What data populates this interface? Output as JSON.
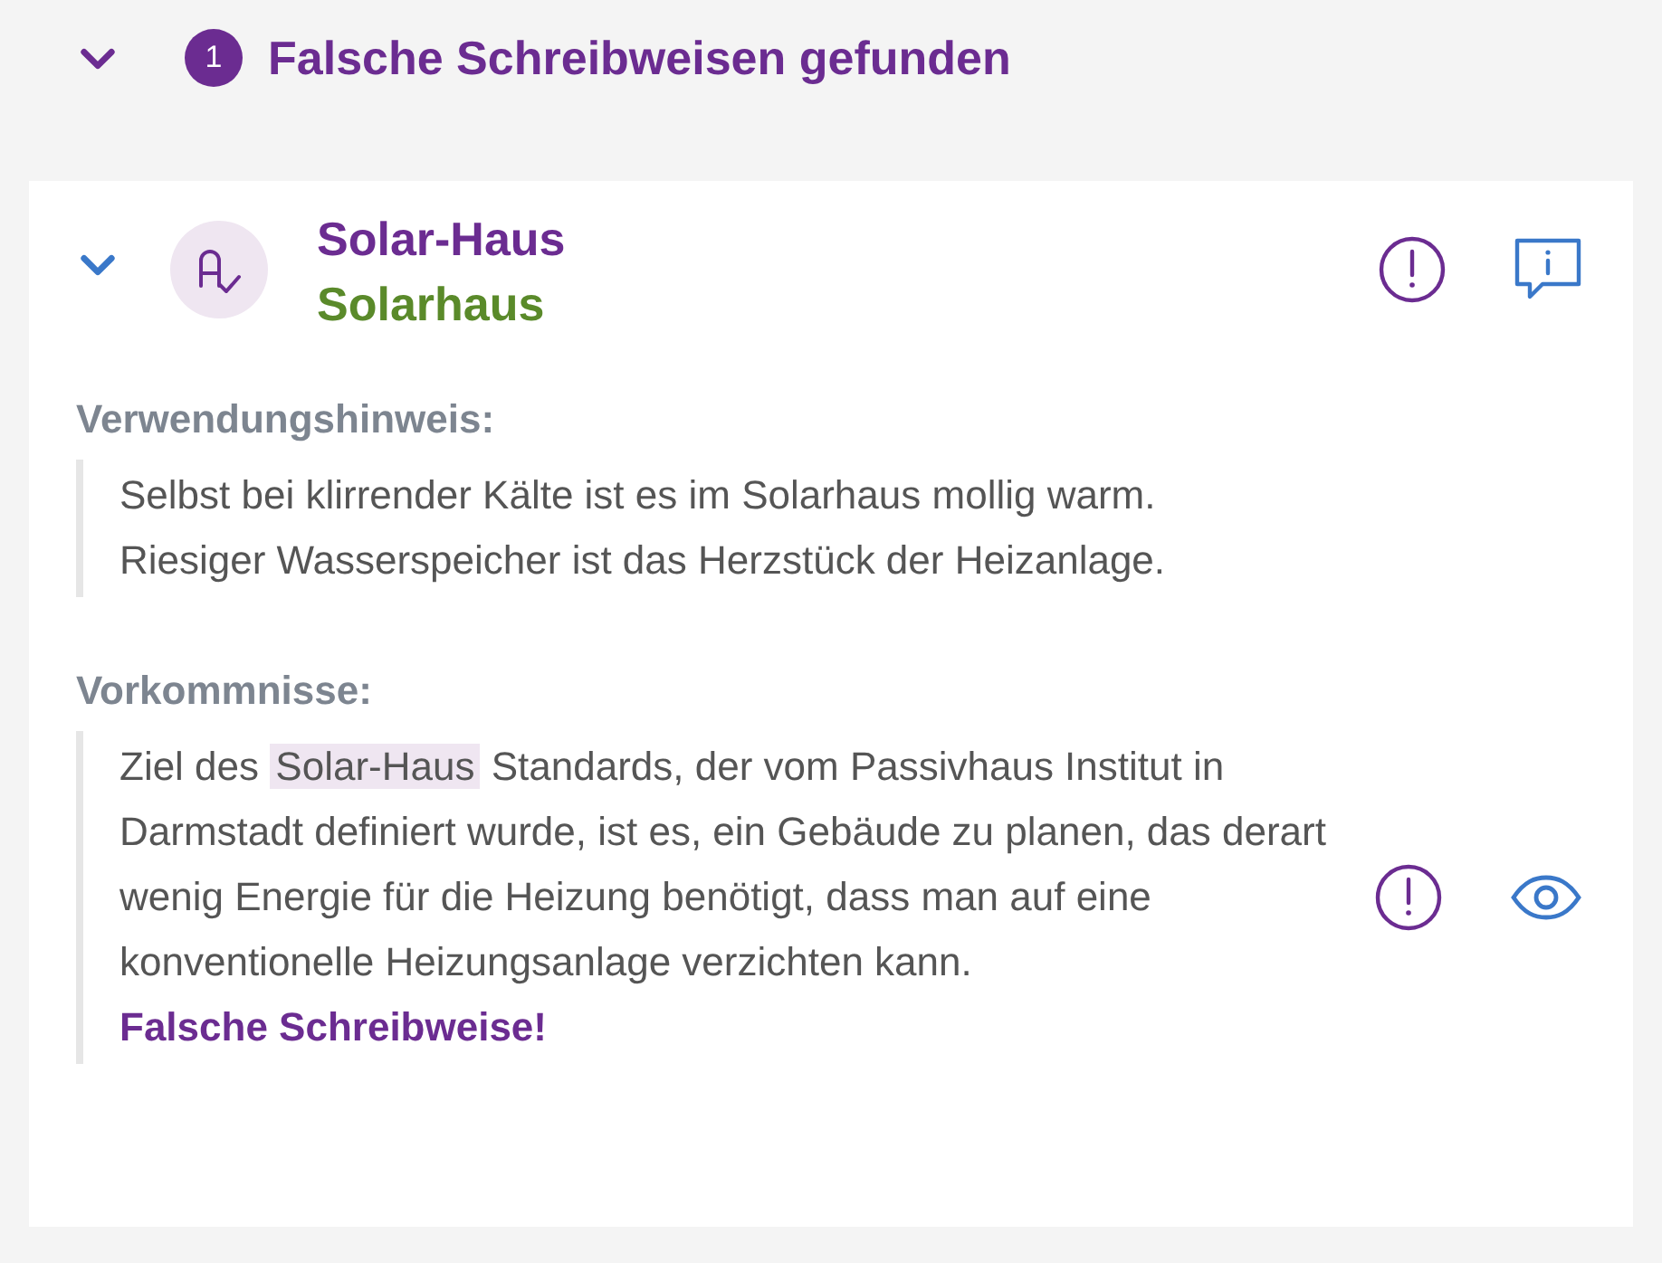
{
  "group": {
    "expanded": true,
    "count": "1",
    "title": "Falsche Schreibweisen gefunden"
  },
  "entry": {
    "expanded": true,
    "term": "Solar-Haus",
    "suggestion": "Solarhaus",
    "usage_label": "Verwendungshinweis:",
    "usage_lines": [
      "Selbst bei klirrender Kälte ist es im Solarhaus mollig warm.",
      "Riesiger Wasserspeicher ist das Herzstück der Heizanlage."
    ],
    "occurrences_label": "Vorkommnisse:",
    "occurrence": {
      "before": "Ziel des",
      "highlight": "Solar-Haus",
      "after": "Standards, der vom Passivhaus Institut in Darmstadt definiert wurde, ist es, ein Gebäude zu planen, das derart wenig Energie für die Heizung benötigt, dass man auf eine konventionelle Heizungsanlage verzichten kann.",
      "verdict": "Falsche Schreibweise!"
    }
  }
}
